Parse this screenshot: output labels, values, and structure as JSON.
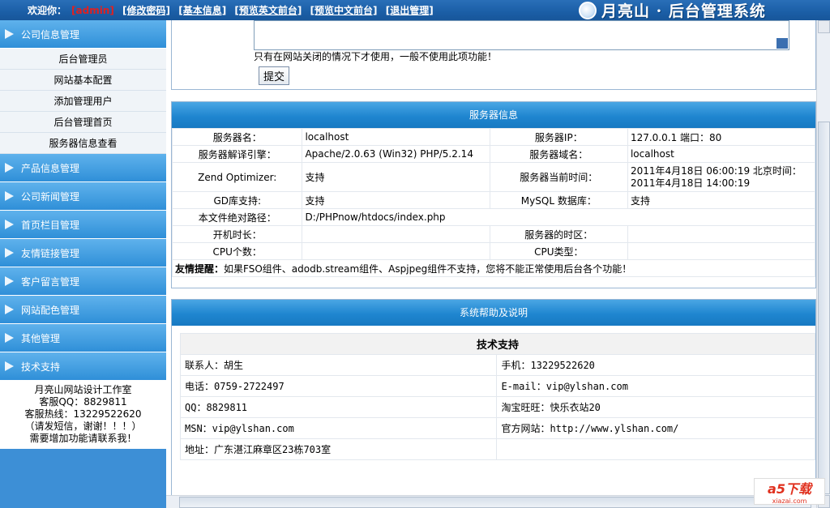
{
  "topbar": {
    "welcome": "欢迎你：",
    "user": "[admin]",
    "links": [
      "[修改密码]",
      "[基本信息]",
      "[预览英文前台]",
      "[预览中文前台]",
      "[退出管理]"
    ],
    "brand": "月亮山 · 后台管理系统"
  },
  "sidebar": {
    "groups": [
      {
        "label": "公司信息管理",
        "items": [
          "后台管理员",
          "网站基本配置",
          "添加管理用户",
          "后台管理首页",
          "服务器信息查看"
        ]
      },
      {
        "label": "产品信息管理"
      },
      {
        "label": "公司新闻管理"
      },
      {
        "label": "首页栏目管理"
      },
      {
        "label": "友情链接管理"
      },
      {
        "label": "客户留言管理"
      },
      {
        "label": "网站配色管理"
      },
      {
        "label": "其他管理"
      },
      {
        "label": "技术支持"
      }
    ],
    "info": [
      "月亮山网站设计工作室",
      "客服QQ：8829811",
      "客服热线：13229522620",
      "（请发短信，谢谢！！！）",
      "需要增加功能请联系我！"
    ]
  },
  "top_form": {
    "note": "只有在网站关闭的情况下才使用，一般不使用此项功能！",
    "submit": "提交"
  },
  "server_panel": {
    "title": "服务器信息",
    "rows": [
      [
        "服务器名：",
        "localhost",
        "服务器IP：",
        "127.0.0.1 端口：80"
      ],
      [
        "服务器解译引擎：",
        "Apache/2.0.63 (Win32) PHP/5.2.14",
        "服务器域名：",
        "localhost"
      ],
      [
        "Zend Optimizer:",
        "支持",
        "服务器当前时间：",
        "2011年4月18日 06:00:19 北京时间：2011年4月18日 14:00:19"
      ],
      [
        "GD库支持:",
        "支持",
        "MySQL 数据库：",
        "支持"
      ],
      [
        "开机时长：",
        "",
        "服务器的时区：",
        ""
      ],
      [
        "CPU个数：",
        "",
        "CPU类型：",
        ""
      ]
    ],
    "path_label": "本文件绝对路径：",
    "path_value": "D:/PHPnow/htdocs/index.php",
    "tip_label": "友情提醒：",
    "tip_text": "如果FSO组件、adodb.stream组件、Aspjpeg组件不支持，您将不能正常使用后台各个功能！"
  },
  "help_panel": {
    "title": "系统帮助及说明",
    "heading": "技术支持",
    "rows": [
      [
        "联系人：胡生",
        "手机：13229522620"
      ],
      [
        "电话：0759-2722497",
        "E-mail：vip@ylshan.com"
      ],
      [
        "QQ：8829811",
        "淘宝旺旺：快乐衣站20"
      ],
      [
        "MSN：vip@ylshan.com",
        "官方网站：http://www.ylshan.com/"
      ],
      [
        "地址：广东湛江麻章区23栋703室",
        ""
      ]
    ]
  },
  "watermark": {
    "line1": "a5下载",
    "line2": "xiazai.com"
  },
  "colors": {
    "topbar": "#1b5ea6",
    "menu": "#2f8fd8",
    "sidebar_bg": "#3d8fd6",
    "panel_head": "#1f86d0",
    "admin": "#e02020"
  }
}
